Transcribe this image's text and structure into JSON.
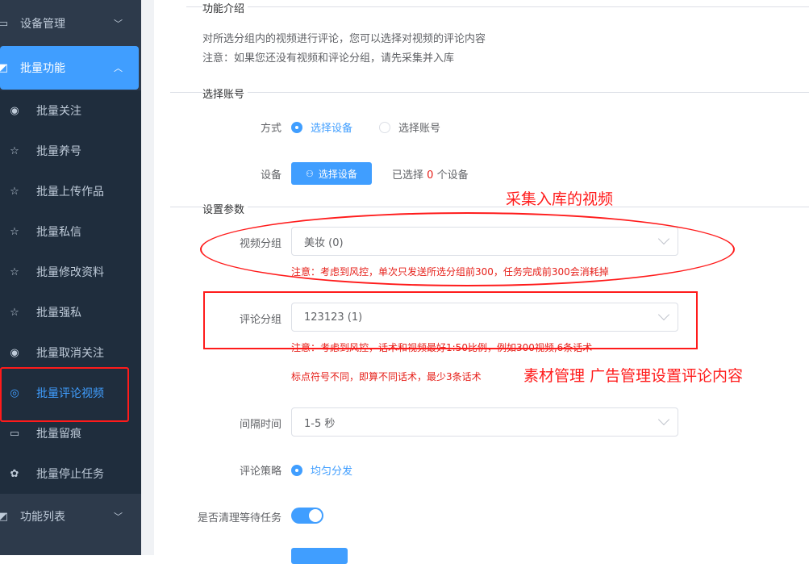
{
  "sidebar": {
    "top_items": [
      {
        "label": "设备管理",
        "icon": "monitor-icon"
      },
      {
        "label": "批量功能",
        "icon": "chart-icon"
      },
      {
        "label": "功能列表",
        "icon": "list-icon"
      }
    ],
    "sub_items": [
      {
        "label": "批量关注",
        "icon": "eye-icon"
      },
      {
        "label": "批量养号",
        "icon": "star-icon"
      },
      {
        "label": "批量上传作品",
        "icon": "star-icon"
      },
      {
        "label": "批量私信",
        "icon": "star-icon"
      },
      {
        "label": "批量修改资料",
        "icon": "star-icon"
      },
      {
        "label": "批量强私",
        "icon": "star-icon"
      },
      {
        "label": "批量取消关注",
        "icon": "eye-icon"
      },
      {
        "label": "批量评论视频",
        "icon": "camera-icon"
      },
      {
        "label": "批量留痕",
        "icon": "tag-icon"
      },
      {
        "label": "批量停止任务",
        "icon": "gear-icon"
      }
    ],
    "accent_color": "#409eff"
  },
  "intro": {
    "title": "功能介绍",
    "line1": "对所选分组内的视频进行评论，您可以选择对视频的评论内容",
    "line2": "注意：如果您还没有视频和评论分组，请先采集并入库"
  },
  "account": {
    "title": "选择账号",
    "method_label": "方式",
    "option_device": "选择设备",
    "option_account": "选择账号",
    "device_label": "设备",
    "device_button": "选择设备",
    "selected_prefix": "已选择",
    "selected_count": "0",
    "selected_suffix": "个设备"
  },
  "params": {
    "title": "设置参数",
    "video_group_label": "视频分组",
    "video_group_value": "美妆 (0)",
    "video_hint": "注意：考虑到风控，单次只发送所选分组前300，任务完成前300会消耗掉",
    "comment_group_label": "评论分组",
    "comment_group_value": "123123 (1)",
    "comment_hint1": "注意：考虑到风控，话术和视频最好1:50比例，例如300视频,6条话术",
    "comment_hint2": "标点符号不同，即算不同话术，最少3条话术",
    "interval_label": "间隔时间",
    "interval_value": "1-5 秒",
    "strategy_label": "评论策略",
    "strategy_value": "均匀分发",
    "clear_label": "是否清理等待任务"
  },
  "annotations": {
    "video_note": "采集入库的视频",
    "comment_note": "素材管理 广告管理设置评论内容"
  }
}
